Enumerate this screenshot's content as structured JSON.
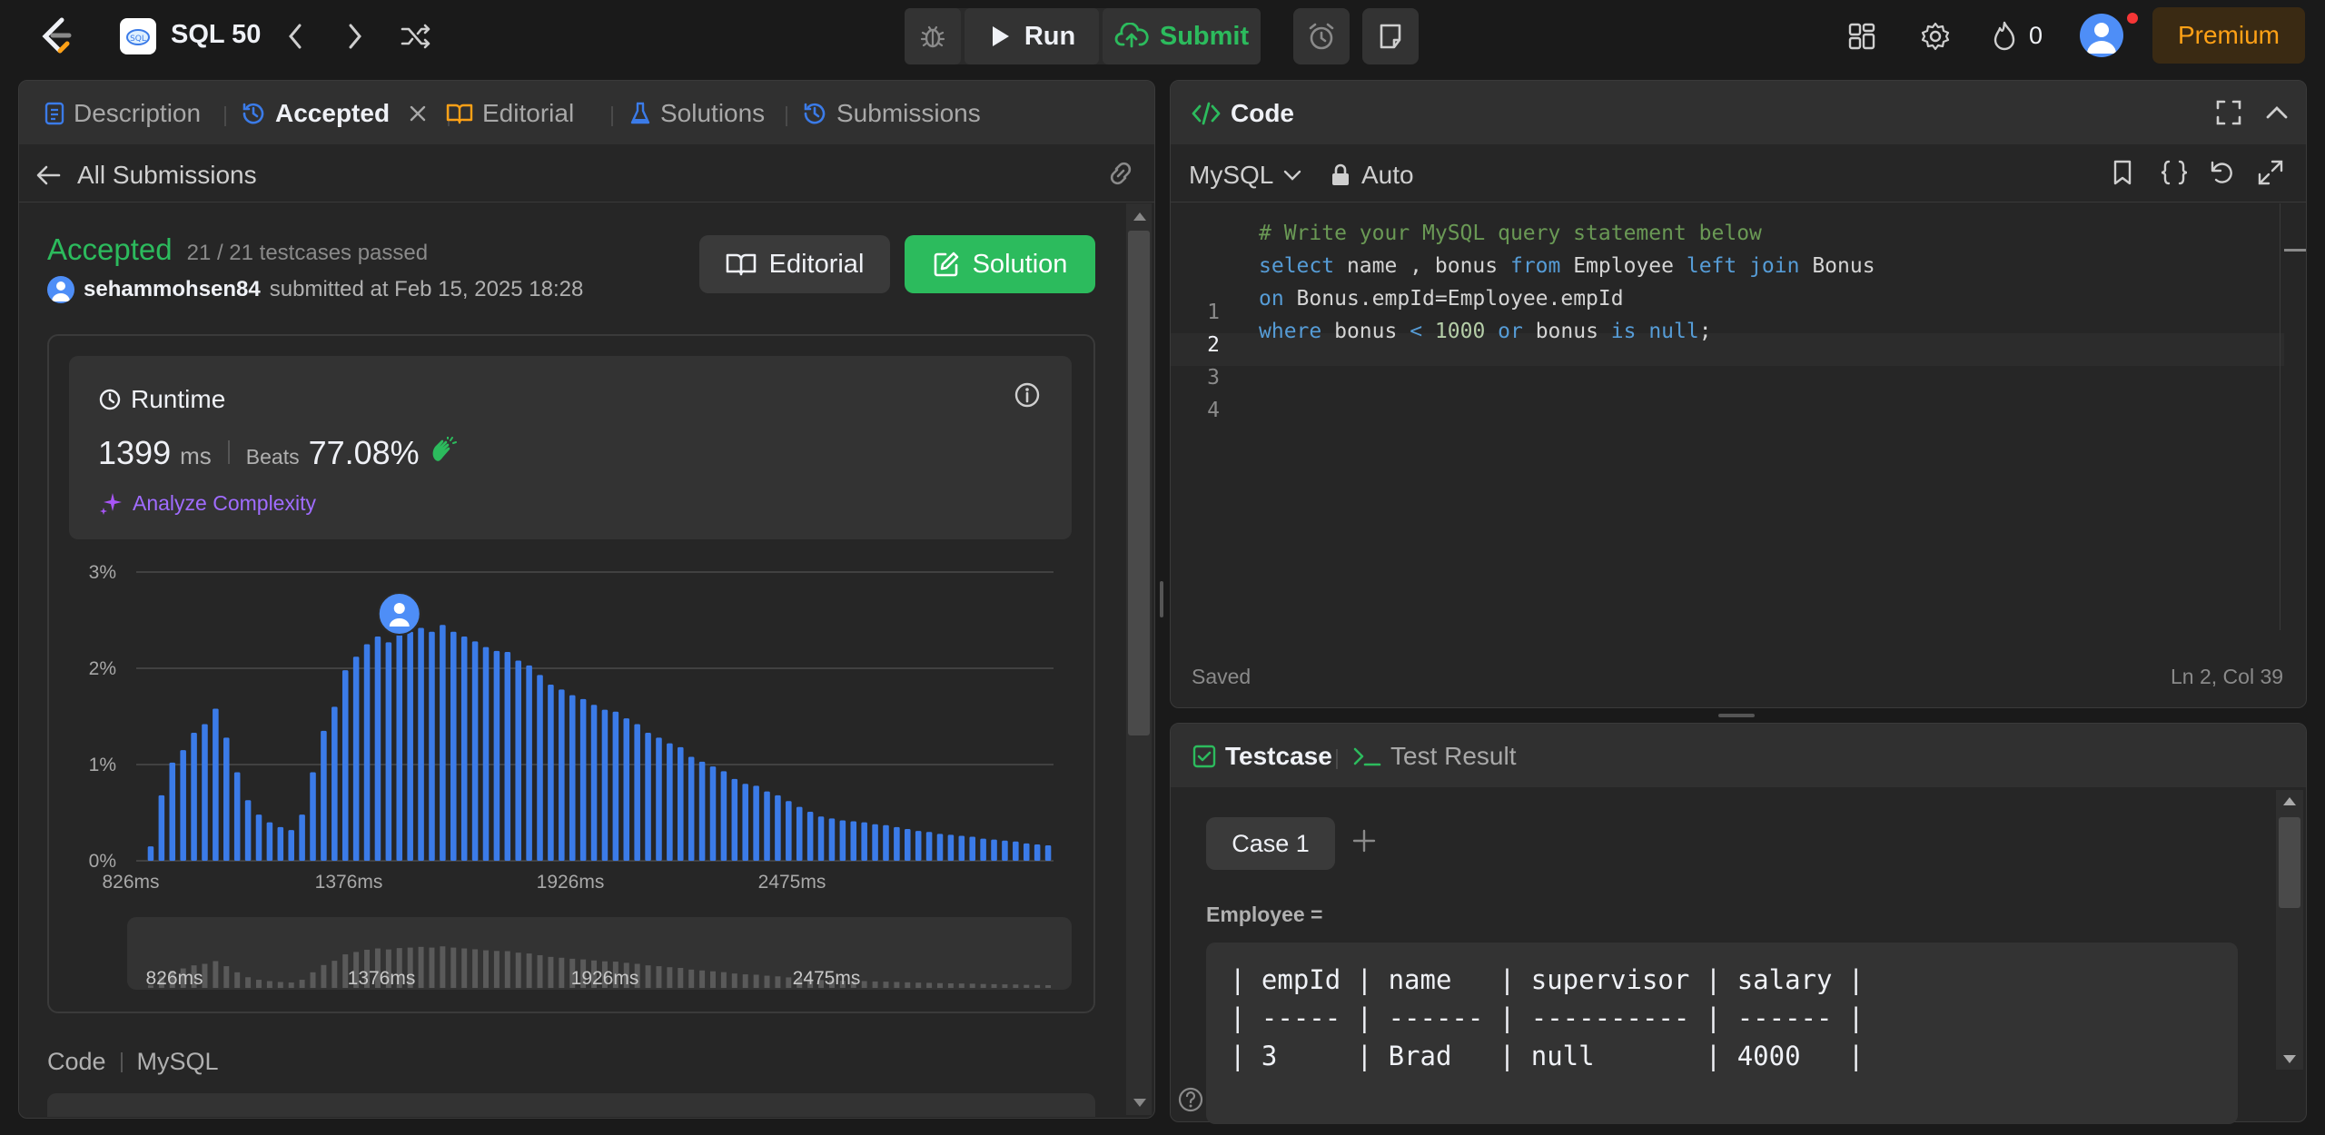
{
  "topbar": {
    "title": "SQL 50",
    "run_label": "Run",
    "submit_label": "Submit",
    "streak_count": "0",
    "premium_label": "Premium"
  },
  "left": {
    "tabs": [
      {
        "label": "Description",
        "icon": "document-icon"
      },
      {
        "label": "Accepted",
        "icon": "history-icon"
      },
      {
        "label": "Editorial",
        "icon": "book-icon"
      },
      {
        "label": "Solutions",
        "icon": "flask-icon"
      },
      {
        "label": "Submissions",
        "icon": "history-icon"
      }
    ],
    "back_label": "All Submissions",
    "status": "Accepted",
    "testcases": "21 / 21 testcases passed",
    "username": "sehammohsen84",
    "submitted_text": "submitted at Feb 15, 2025 18:28",
    "editorial_btn": "Editorial",
    "solution_btn": "Solution",
    "runtime": {
      "label": "Runtime",
      "value": "1399",
      "unit": "ms",
      "beats_label": "Beats",
      "beats_value": "77.08%",
      "analyze_label": "Analyze Complexity"
    },
    "code_label": "Code",
    "lang_label": "MySQL"
  },
  "chart_data": {
    "type": "bar",
    "ytick_labels": [
      "3%",
      "2%",
      "1%",
      "0%"
    ],
    "xtick_labels": [
      "826ms",
      "1376ms",
      "1926ms",
      "2475ms"
    ],
    "ylim": [
      0,
      3
    ],
    "grid": true,
    "marker_index": 23,
    "values": [
      0.15,
      0.68,
      1.02,
      1.15,
      1.33,
      1.42,
      1.58,
      1.28,
      0.92,
      0.63,
      0.48,
      0.4,
      0.35,
      0.32,
      0.48,
      0.92,
      1.35,
      1.6,
      1.98,
      2.12,
      2.25,
      2.33,
      2.27,
      2.35,
      2.38,
      2.42,
      2.38,
      2.45,
      2.38,
      2.33,
      2.28,
      2.22,
      2.18,
      2.17,
      2.08,
      2.03,
      1.93,
      1.83,
      1.78,
      1.72,
      1.68,
      1.62,
      1.57,
      1.55,
      1.48,
      1.42,
      1.33,
      1.28,
      1.22,
      1.18,
      1.08,
      1.03,
      0.98,
      0.93,
      0.85,
      0.8,
      0.78,
      0.72,
      0.68,
      0.62,
      0.56,
      0.51,
      0.46,
      0.44,
      0.42,
      0.41,
      0.4,
      0.38,
      0.37,
      0.35,
      0.33,
      0.31,
      0.3,
      0.28,
      0.27,
      0.26,
      0.25,
      0.23,
      0.22,
      0.21,
      0.2,
      0.18,
      0.17,
      0.16
    ]
  },
  "right": {
    "code_title": "Code",
    "language": "MySQL",
    "auto_label": "Auto",
    "saved_label": "Saved",
    "cursor_pos": "Ln 2, Col 39",
    "testcase_tab": "Testcase",
    "testresult_tab": "Test Result",
    "case_label": "Case 1",
    "table_label": "Employee =",
    "table_lines": [
      "| empId | name   | supervisor | salary |",
      "| ----- | ------ | ---------- | ------ |",
      "| 3     | Brad   | null       | 4000   |"
    ]
  },
  "colors": {
    "accent_green": "#2cbb5d",
    "bar_blue": "#3b7be8",
    "premium_orange": "#ffa116"
  }
}
